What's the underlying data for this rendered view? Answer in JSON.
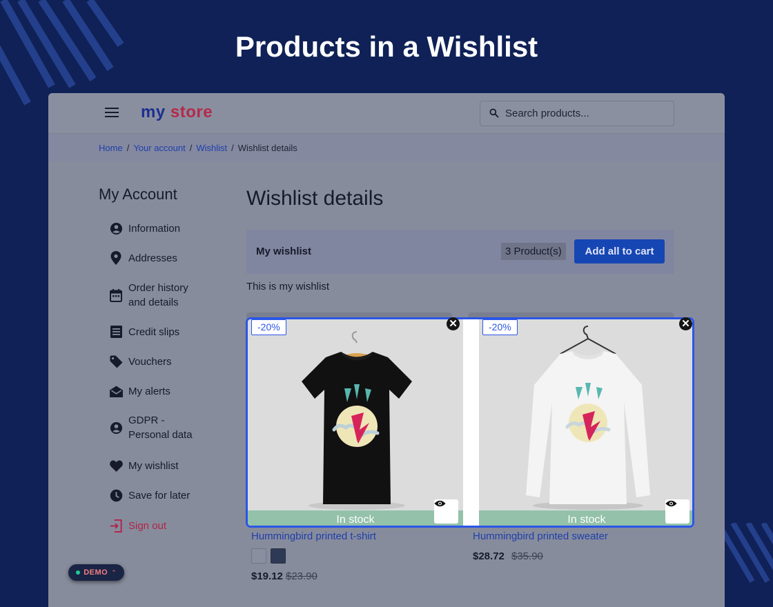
{
  "page": {
    "title": "Products in a Wishlist"
  },
  "header": {
    "logo_part1": "my",
    "logo_part2": "store",
    "search_placeholder": "Search products..."
  },
  "breadcrumb": [
    {
      "label": "Home",
      "link": true
    },
    {
      "label": "Your account",
      "link": true
    },
    {
      "label": "Wishlist",
      "link": true
    },
    {
      "label": "Wishlist details",
      "link": false
    }
  ],
  "sidebar": {
    "title": "My Account",
    "items": [
      {
        "label": "Information",
        "icon": "account-circle-icon"
      },
      {
        "label": "Addresses",
        "icon": "location-pin-icon"
      },
      {
        "label": "Order history and details",
        "icon": "calendar-icon"
      },
      {
        "label": "Credit slips",
        "icon": "receipt-icon"
      },
      {
        "label": "Vouchers",
        "icon": "tag-icon"
      },
      {
        "label": "My alerts",
        "icon": "mail-open-icon"
      },
      {
        "label": "GDPR - Personal data",
        "icon": "account-circle-icon"
      },
      {
        "label": "My wishlist",
        "icon": "heart-icon"
      },
      {
        "label": "Save for later",
        "icon": "clock-icon"
      },
      {
        "label": "Sign out",
        "icon": "logout-icon"
      }
    ]
  },
  "main": {
    "title": "Wishlist details",
    "wishlist_name": "My wishlist",
    "product_count": "3 Product(s)",
    "add_all_label": "Add all to cart",
    "description": "This is my wishlist"
  },
  "products": [
    {
      "name": "Hummingbird printed t-shirt",
      "discount": "-20%",
      "stock": "In stock",
      "price": "$19.12",
      "old_price": "$23.90",
      "colors": [
        "#8a8fa0",
        "#2e3a55"
      ]
    },
    {
      "name": "Hummingbird printed sweater",
      "discount": "-20%",
      "stock": "In stock",
      "price": "$28.72",
      "old_price": "$35.90"
    }
  ],
  "demo_badge": "DEMO",
  "colors": {
    "accent": "#2a56e8",
    "primary_button": "#1646b3",
    "link": "#1e3faa",
    "sign_out": "#b02347",
    "in_stock": "#93c1aa",
    "background": "#0f2156"
  }
}
